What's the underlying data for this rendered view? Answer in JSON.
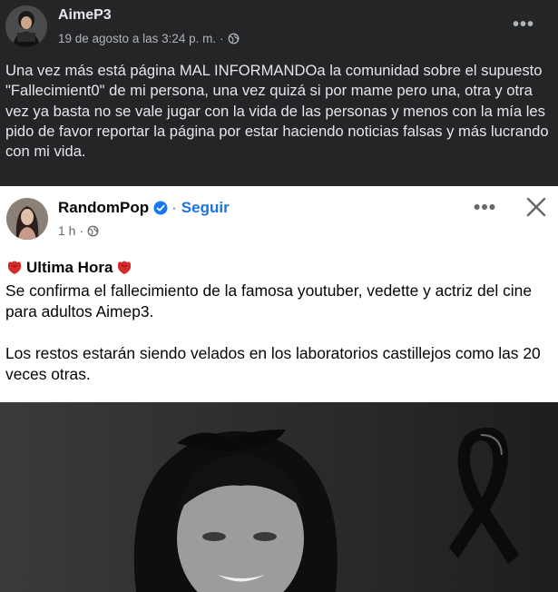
{
  "outer_post": {
    "author": "AimeP3",
    "timestamp": "19 de agosto a las 3:24 p. m.",
    "dot": "·",
    "audience_icon": "globe-icon",
    "more_icon": "more-options-icon",
    "more_label": "•••",
    "text": "Una vez más está página MAL INFORMANDOa la comunidad sobre el supuesto \"Fallecimient0\" de mi persona, una vez quizá si por mame pero una, otra y otra vez ya basta no se vale jugar con la vida de las personas y menos con la mía les pido de favor reportar la página por estar haciendo noticias falsas y más lucrando con mi vida."
  },
  "shared_screenshot": {
    "page_name": "RandomPop",
    "verified_icon": "verified-badge-icon",
    "separator": "·",
    "follow_label": "Seguir",
    "time": "1 h",
    "dot": "·",
    "audience_icon": "globe-icon",
    "more_label": "•••",
    "close_icon": "close-icon",
    "alert_label": "Ultima Hora",
    "alert_icon": "red-flower-icon",
    "paragraph_1": "Se confirma el fallecimiento de la famosa youtuber, vedette y actriz del cine para adultos Aimep3.",
    "paragraph_2": "Los restos estarán siendo velados en los laboratorios castillejos como las 20 veces otras.",
    "image_icons": [
      "black-mourning-ribbon-icon"
    ]
  },
  "colors": {
    "dark_background": "#242526",
    "dark_text": "#e4e6eb",
    "dark_secondary": "#b0b3b8",
    "light_background": "#ffffff",
    "light_text": "#050505",
    "light_secondary": "#65676b",
    "link_blue": "#1b74e4",
    "alert_red": "#d62b2b"
  }
}
